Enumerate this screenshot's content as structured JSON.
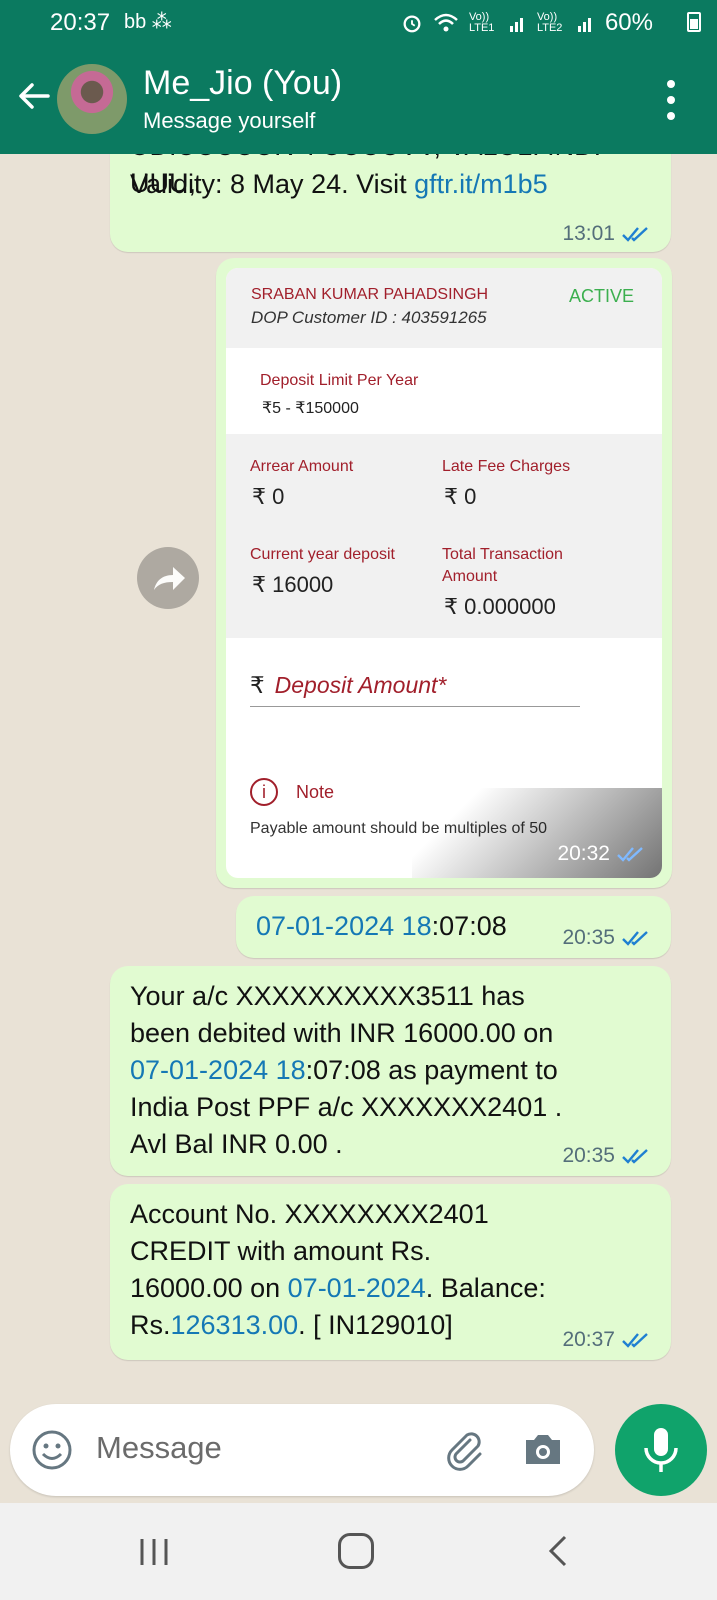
{
  "status_bar": {
    "time": "20:37",
    "left_icons": "bb ⁂",
    "network_1": "Vo)) LTE1",
    "network_2": "Vo)) LTE2",
    "battery": "60%",
    "icons": [
      "alarm-icon",
      "wifi-icon",
      "signal-icon",
      "battery-icon"
    ]
  },
  "header": {
    "contact_name": "Me_Jio (You)",
    "subtitle": "Message yourself"
  },
  "messages": [
    {
      "line1": "UDIUUUUUIV I UUUUVV, VALUL. IND. UUU,",
      "line2_prefix": "Validity: 8 May 24.  Visit ",
      "link": "gftr.it/m1b5",
      "time": "13:01"
    },
    {
      "image_card": {
        "holder": "SRABAN KUMAR PAHADSINGH",
        "customer_id": "DOP Customer ID : 403591265",
        "status": "ACTIVE",
        "deposit_limit_label": "Deposit Limit Per Year",
        "deposit_limit_value": "₹5 - ₹150000",
        "arrear_label": "Arrear Amount",
        "arrear_value": "₹ 0",
        "late_fee_label": "Late Fee Charges",
        "late_fee_value": "₹ 0",
        "current_deposit_label": "Current year deposit",
        "current_deposit_value": "₹ 16000",
        "total_txn_label_1": "Total Transaction",
        "total_txn_label_2": "Amount",
        "total_txn_value": "₹ 0.000000",
        "rupee_symbol": "₹",
        "deposit_placeholder": "Deposit Amount*",
        "note_title": "Note",
        "note_text": "Payable amount should be multiples of 50"
      },
      "time": "20:32"
    },
    {
      "link": "07-01-2024 18",
      "rest": ":07:08",
      "time": "20:35"
    },
    {
      "line1": "Your a/c XXXXXXXXXX3511 has",
      "line2": "been debited with INR 16000.00 on",
      "line3_link": "07-01-2024 18",
      "line3_rest": ":07:08 as payment to",
      "line4": "India Post PPF a/c XXXXXXX2401 .",
      "line5": "Avl Bal INR 0.00 .",
      "time": "20:35"
    },
    {
      "line1": "Account  No. XXXXXXXX2401",
      "line2": "CREDIT with amount Rs.",
      "line3_prefix": "16000.00 on ",
      "line3_link": "07-01-2024",
      "line3_suffix": ". Balance:",
      "line4_prefix": "Rs.",
      "line4_link": "126313.00",
      "line4_suffix": ". [ IN129010]",
      "time": "20:37"
    }
  ],
  "composer": {
    "placeholder": "Message"
  },
  "colors": {
    "header": "#0b7a60",
    "bubble": "#e1fbd1",
    "link": "#1578b5",
    "mic": "#10a36b",
    "chat_bg": "#e9e2d6"
  }
}
